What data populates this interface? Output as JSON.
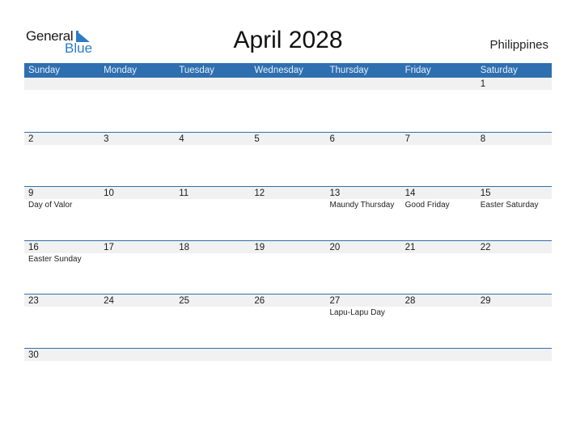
{
  "logo": {
    "line1": "General",
    "line2": "Blue"
  },
  "title": "April 2028",
  "country": "Philippines",
  "colors": {
    "accent": "#2e6fb0",
    "band": "#f1f1f1",
    "logo_blue": "#2b7bc7"
  },
  "weekdays": [
    "Sunday",
    "Monday",
    "Tuesday",
    "Wednesday",
    "Thursday",
    "Friday",
    "Saturday"
  ],
  "weeks": [
    [
      {
        "day": "",
        "holiday": ""
      },
      {
        "day": "",
        "holiday": ""
      },
      {
        "day": "",
        "holiday": ""
      },
      {
        "day": "",
        "holiday": ""
      },
      {
        "day": "",
        "holiday": ""
      },
      {
        "day": "",
        "holiday": ""
      },
      {
        "day": "1",
        "holiday": ""
      }
    ],
    [
      {
        "day": "2",
        "holiday": ""
      },
      {
        "day": "3",
        "holiday": ""
      },
      {
        "day": "4",
        "holiday": ""
      },
      {
        "day": "5",
        "holiday": ""
      },
      {
        "day": "6",
        "holiday": ""
      },
      {
        "day": "7",
        "holiday": ""
      },
      {
        "day": "8",
        "holiday": ""
      }
    ],
    [
      {
        "day": "9",
        "holiday": "Day of Valor"
      },
      {
        "day": "10",
        "holiday": ""
      },
      {
        "day": "11",
        "holiday": ""
      },
      {
        "day": "12",
        "holiday": ""
      },
      {
        "day": "13",
        "holiday": "Maundy Thursday"
      },
      {
        "day": "14",
        "holiday": "Good Friday"
      },
      {
        "day": "15",
        "holiday": "Easter Saturday"
      }
    ],
    [
      {
        "day": "16",
        "holiday": "Easter Sunday"
      },
      {
        "day": "17",
        "holiday": ""
      },
      {
        "day": "18",
        "holiday": ""
      },
      {
        "day": "19",
        "holiday": ""
      },
      {
        "day": "20",
        "holiday": ""
      },
      {
        "day": "21",
        "holiday": ""
      },
      {
        "day": "22",
        "holiday": ""
      }
    ],
    [
      {
        "day": "23",
        "holiday": ""
      },
      {
        "day": "24",
        "holiday": ""
      },
      {
        "day": "25",
        "holiday": ""
      },
      {
        "day": "26",
        "holiday": ""
      },
      {
        "day": "27",
        "holiday": "Lapu-Lapu Day"
      },
      {
        "day": "28",
        "holiday": ""
      },
      {
        "day": "29",
        "holiday": ""
      }
    ],
    [
      {
        "day": "30",
        "holiday": ""
      },
      {
        "day": "",
        "holiday": ""
      },
      {
        "day": "",
        "holiday": ""
      },
      {
        "day": "",
        "holiday": ""
      },
      {
        "day": "",
        "holiday": ""
      },
      {
        "day": "",
        "holiday": ""
      },
      {
        "day": "",
        "holiday": ""
      }
    ]
  ]
}
